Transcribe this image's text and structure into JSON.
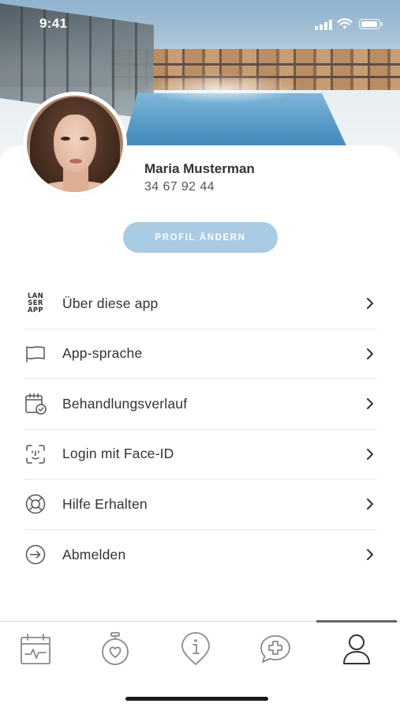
{
  "status_bar": {
    "time": "9:41"
  },
  "profile": {
    "name": "Maria Musterman",
    "phone": "34 67 92 44",
    "edit_button": "PROFIL ÄNDERN"
  },
  "menu": {
    "items": [
      {
        "label": "Über diese app",
        "icon": "lanserhof-logo-icon",
        "logo_text": [
          "LAN",
          "SER",
          "APP"
        ]
      },
      {
        "label": "App-sprache",
        "icon": "flag-icon"
      },
      {
        "label": "Behandlungsverlauf",
        "icon": "calendar-check-icon"
      },
      {
        "label": "Login mit Face-ID",
        "icon": "face-id-icon"
      },
      {
        "label": "Hilfe Erhalten",
        "icon": "lifebuoy-icon"
      },
      {
        "label": "Abmelden",
        "icon": "logout-icon"
      }
    ]
  },
  "tabbar": {
    "tabs": [
      {
        "icon": "calendar-pulse-icon",
        "active": false
      },
      {
        "icon": "stopwatch-heart-icon",
        "active": false
      },
      {
        "icon": "info-pin-icon",
        "active": false
      },
      {
        "icon": "chat-plus-icon",
        "active": false
      },
      {
        "icon": "user-icon",
        "active": true
      }
    ]
  },
  "colors": {
    "button_bg": "#a9cbe3",
    "text": "#333333",
    "divider": "#e8e8e8",
    "icon": "#555555"
  }
}
